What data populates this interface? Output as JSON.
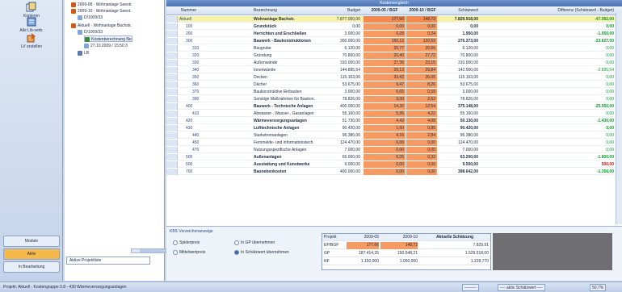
{
  "leftbar": {
    "items": [
      {
        "label": "Kopieren",
        "icon": "copy-icon"
      },
      {
        "label": "Alle Lib-verb.",
        "icon": "library-icon"
      },
      {
        "label": "LV erstellen",
        "icon": "create-lv-icon"
      }
    ],
    "module_label": "Module",
    "active_label": "Aktiv",
    "third_label": "In Bearbeitung"
  },
  "tree": {
    "rows": [
      {
        "label": "2009-08 · Wohnanlage Seestr.",
        "indent": 0
      },
      {
        "label": "2009-10 · Wohnanlage Seest.",
        "indent": 0
      },
      {
        "label": "D/1009/33",
        "indent": 1
      },
      {
        "label": "Aktuell · Wohnanlage Bachstr.",
        "indent": 0
      },
      {
        "label": "D/1009/33",
        "indent": 1
      },
      {
        "label": "Kostenberechnung Ne",
        "indent": 2
      },
      {
        "label": "27.10.2009 / 15:50:3",
        "indent": 2
      },
      {
        "label": "LB",
        "indent": 1
      }
    ],
    "project_select": "Aktive Projektliste"
  },
  "grid": {
    "title": "Kostenvergleich",
    "headers": {
      "nummer": "Nummer",
      "bezeichnung": "Bezeichnung",
      "budget": "Budget",
      "col_o1": "2009-05 / BGF",
      "col_o2": "2009-10 / BGF",
      "schaetzwert": "Schätzwert",
      "differenz": "Differenz (Schätzwert - Budget)"
    },
    "rows": [
      {
        "num": "Aktuell",
        "desc": "Wohnanlage Bachstr.",
        "bud": "7.877.000,00",
        "o1": "177,66",
        "o2": "148,73",
        "schl": "7.829.918,00",
        "diff": "-47.082,00",
        "hl": true,
        "bold": true
      },
      {
        "num": "100",
        "desc": "Grundstück",
        "bud": "0,00",
        "o1": "0,00",
        "o2": "0,00",
        "schl": "0,00",
        "diff": "0,00",
        "bold": true
      },
      {
        "num": "200",
        "desc": "Herrichten und Erschließen",
        "bud": "3.000,00",
        "o1": "0,28",
        "o2": "0,24",
        "schl": "1.950,00",
        "diff": "-1.050,00",
        "bold": true
      },
      {
        "num": "300",
        "desc": "Bauwerk - Baukonstruktionen",
        "bud": "300.000,00",
        "o1": "150,12",
        "o2": "120,59",
        "schl": "276.373,00",
        "diff": "-23.627,00",
        "bold": true
      },
      {
        "num": "310",
        "desc": "Baugrube",
        "bud": "6.120,00",
        "o1": "20,77",
        "o2": "20,66",
        "schl": "6.120,00",
        "diff": "0,00"
      },
      {
        "num": "320",
        "desc": "Gründung",
        "bud": "70.800,00",
        "o1": "20,40",
        "o2": "27,72",
        "schl": "70.800,00",
        "diff": "0,00"
      },
      {
        "num": "330",
        "desc": "Außenwände",
        "bud": "310.000,00",
        "o1": "27,36",
        "o2": "23,15",
        "schl": "310.000,00",
        "diff": "0,00"
      },
      {
        "num": "340",
        "desc": "Innenwände",
        "bud": "144.895,54",
        "o1": "39,13",
        "o2": "29,84",
        "schl": "142.000,00",
        "diff": "-2.895,54"
      },
      {
        "num": "350",
        "desc": "Decken",
        "bud": "115.163,00",
        "o1": "33,42",
        "o2": "26,05",
        "schl": "115.163,00",
        "diff": "0,00"
      },
      {
        "num": "360",
        "desc": "Dächer",
        "bud": "53.675,00",
        "o1": "9,47",
        "o2": "8,26",
        "schl": "53.675,00",
        "diff": "0,00"
      },
      {
        "num": "370",
        "desc": "Baukonstruktive Einbauten",
        "bud": "3.000,00",
        "o1": "0,65",
        "o2": "0,59",
        "schl": "3.000,00",
        "diff": "0,00"
      },
      {
        "num": "390",
        "desc": "Sonstige Maßnahmen für Baukon.",
        "bud": "78.826,00",
        "o1": "3,00",
        "o2": "2,62",
        "schl": "78.826,00",
        "diff": "0,00"
      },
      {
        "num": "400",
        "desc": "Bauwerk - Technische Anlagen",
        "bud": "400.000,00",
        "o1": "14,30",
        "o2": "12,54",
        "schl": "375.148,00",
        "diff": "-25.050,00",
        "bold": true
      },
      {
        "num": "410",
        "desc": "Abwasser-, Wasser-, Gasanlagen",
        "bud": "55.160,00",
        "o1": "5,95",
        "o2": "4,22",
        "schl": "55.160,00",
        "diff": "0,00"
      },
      {
        "num": "420",
        "desc": "Wärmeversorgungsanlagen",
        "bud": "51.730,00",
        "o1": "4,42",
        "o2": "4,08",
        "schl": "50.130,00",
        "diff": "-1.430,00",
        "bold": true
      },
      {
        "num": "430",
        "desc": "Lufttechnische Anlagen",
        "bud": "90.420,00",
        "o1": "1,60",
        "o2": "0,85",
        "schl": "90.420,00",
        "diff": "0,00",
        "bold": true
      },
      {
        "num": "440",
        "desc": "Starkstromanlagen",
        "bud": "96.380,00",
        "o1": "4,16",
        "o2": "2,84",
        "schl": "96.380,00",
        "diff": "0,00"
      },
      {
        "num": "450",
        "desc": "Fernmelde- und informationstech.",
        "bud": "124.470,00",
        "o1": "0,00",
        "o2": "0,00",
        "schl": "124.470,00",
        "diff": "0,00"
      },
      {
        "num": "470",
        "desc": "Nutzungsspezifische Anlagen",
        "bud": "7.000,00",
        "o1": "0,00",
        "o2": "0,00",
        "schl": "7.000,00",
        "diff": "0,00"
      },
      {
        "num": "500",
        "desc": "Außenanlagen",
        "bud": "65.000,00",
        "o1": "0,35",
        "o2": "0,32",
        "schl": "63.200,00",
        "diff": "-1.800,00",
        "bold": true
      },
      {
        "num": "600",
        "desc": "Ausstattung und Kunstwerke",
        "bud": "9.000,00",
        "o1": "0,00",
        "o2": "0,00",
        "schl": "9.500,00",
        "diff": "500,00",
        "bold": true,
        "neg": true
      },
      {
        "num": "700",
        "desc": "Baunebenkosten",
        "bud": "400.000,00",
        "o1": "0,00",
        "o2": "0,00",
        "schl": "398.642,00",
        "diff": "-1.358,00",
        "bold": true
      }
    ]
  },
  "bottom": {
    "panel_title": "KBS Vorzeichenanzeige",
    "radio1": "Spiderpreis",
    "radio2": "Mittelwertpreis",
    "radio3": "In GP übernehmen",
    "radio4": "In Schätzwert übernehmen",
    "mini_headers": [
      "Projekt",
      "2009-05",
      "2009-10",
      "Aktuelle Schätzung"
    ],
    "mini_rows": [
      {
        "label": "EP/BGF",
        "v1": "177,66",
        "v2": "148,73",
        "v3": "7.829,91"
      },
      {
        "label": "GP",
        "v1": "187.414,35",
        "v2": "150.548,21",
        "v3": "1.529.518,00"
      },
      {
        "label": "NF",
        "v1": "1.150,000",
        "v2": "1.050,000",
        "v3": "1.228,770"
      }
    ]
  },
  "status": {
    "left": "Projekt: Aktuell - Kostengruppe 0.8 - 430 Wärmeversorgungsanlagen",
    "s1": "---------",
    "s2": "---- aktiv Schätzwert ----",
    "s3": "50,7%"
  }
}
